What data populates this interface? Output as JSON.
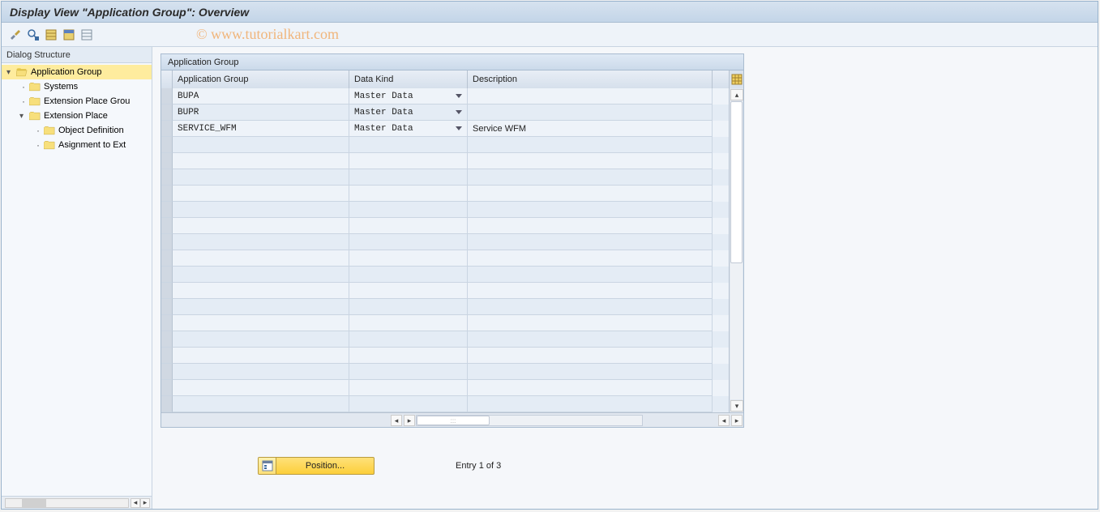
{
  "titlebar": {
    "title": "Display View \"Application Group\": Overview"
  },
  "watermark": "© www.tutorialkart.com",
  "sidebar": {
    "header": "Dialog Structure",
    "nodes": [
      {
        "label": "Application Group",
        "level": 0,
        "expanded": true,
        "selected": true,
        "open": true
      },
      {
        "label": "Systems",
        "level": 1,
        "leaf": true
      },
      {
        "label": "Extension Place Group",
        "level": 1,
        "leaf": true,
        "truncated": "Extension Place Grou"
      },
      {
        "label": "Extension Place",
        "level": 1,
        "expanded": true
      },
      {
        "label": "Object Definition",
        "level": 2,
        "leaf": true
      },
      {
        "label": "Asignment to Ext",
        "level": 2,
        "leaf": true,
        "truncated": "Asignment to Ext"
      }
    ]
  },
  "grid": {
    "title": "Application Group",
    "columns": {
      "app": "Application Group",
      "kind": "Data Kind",
      "desc": "Description"
    },
    "rows": [
      {
        "app": "BUPA",
        "kind": "Master Data",
        "desc": ""
      },
      {
        "app": "BUPR",
        "kind": "Master Data",
        "desc": ""
      },
      {
        "app": "SERVICE_WFM",
        "kind": "Master Data",
        "desc": "Service WFM"
      }
    ],
    "empty_row_count": 17
  },
  "footer": {
    "position_button": "Position...",
    "entry_text": "Entry 1 of 3"
  }
}
